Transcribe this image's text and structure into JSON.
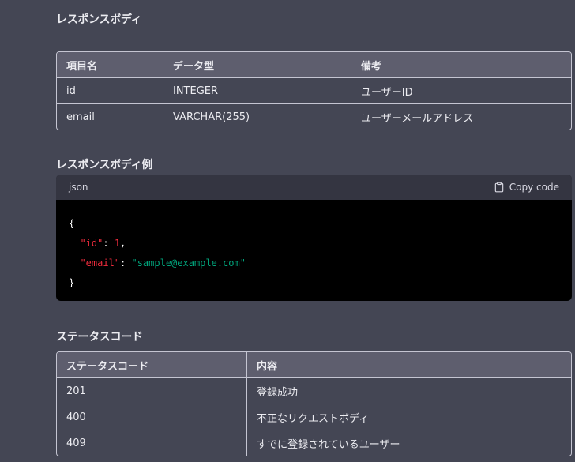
{
  "section1": {
    "title": "レスポンスボディ",
    "headers": [
      "項目名",
      "データ型",
      "備考"
    ],
    "rows": [
      [
        "id",
        "INTEGER",
        "ユーザーID"
      ],
      [
        "email",
        "VARCHAR(255)",
        "ユーザーメールアドレス"
      ]
    ]
  },
  "section2": {
    "title": "レスポンスボディ例",
    "code": {
      "language": "json",
      "copy_label": "Copy code",
      "brace_open": "{",
      "brace_close": "}",
      "key_id": "\"id\"",
      "val_id": "1",
      "key_email": "\"email\"",
      "val_email": "\"sample@example.com\""
    }
  },
  "section3": {
    "title": "ステータスコード",
    "headers": [
      "ステータスコード",
      "内容"
    ],
    "rows": [
      [
        "201",
        "登録成功"
      ],
      [
        "400",
        "不正なリクエストボディ"
      ],
      [
        "409",
        "すでに登録されているユーザー"
      ]
    ]
  },
  "colors": {
    "background": "#444654",
    "table_header": "#5e5e6e",
    "code_bg": "#000000",
    "code_bar": "#343541",
    "json_key": "#f22c3d",
    "json_string": "#00a67d"
  },
  "icons": {
    "copy": "clipboard-icon"
  }
}
